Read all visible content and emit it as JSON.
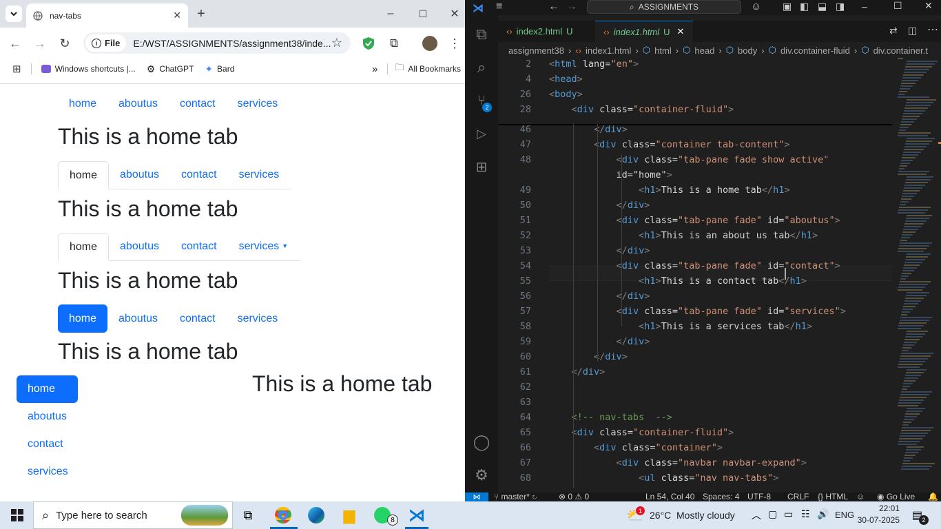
{
  "chrome": {
    "tab_title": "nav-tabs",
    "omnibox": {
      "scheme": "File",
      "url": "E:/WST/ASSIGNMENTS/assignment38/inde..."
    },
    "bookmarks": [
      "Windows shortcuts |...",
      "ChatGPT",
      "Bard"
    ],
    "all_bookmarks": "All Bookmarks",
    "accent": "#0d6efd"
  },
  "page": {
    "nav1": [
      "home",
      "aboutus",
      "contact",
      "services"
    ],
    "heading": "This is a home tab",
    "nav2": [
      "home",
      "aboutus",
      "contact",
      "services"
    ],
    "nav3": [
      "home",
      "aboutus",
      "contact",
      "services"
    ],
    "nav4": [
      "home",
      "aboutus",
      "contact",
      "services"
    ],
    "nav5": [
      "home",
      "aboutus",
      "contact",
      "services"
    ]
  },
  "vscode": {
    "title": "ASSIGNMENTS",
    "tabs": [
      {
        "name": "index2.html",
        "status": "U"
      },
      {
        "name": "index1.html",
        "status": "U"
      }
    ],
    "breadcrumbs": [
      "assignment38",
      "index1.html",
      "html",
      "head",
      "body",
      "div.container-fluid",
      "div.container.t"
    ],
    "sticky": [
      {
        "n": "2",
        "c": "<html lang=\"en\">"
      },
      {
        "n": "4",
        "c": "<head>"
      },
      {
        "n": "26",
        "c": "<body>"
      },
      {
        "n": "28",
        "c": "    <div class=\"container-fluid\">"
      }
    ],
    "lines": [
      {
        "n": "46",
        "c": "        </div>"
      },
      {
        "n": "47",
        "c": "        <div class=\"container tab-content\">"
      },
      {
        "n": "48",
        "c": "            <div class=\"tab-pane fade show active\""
      },
      {
        "n": "",
        "c": "            id=\"home\">"
      },
      {
        "n": "49",
        "c": "                <h1>This is a home tab</h1>"
      },
      {
        "n": "50",
        "c": "            </div>"
      },
      {
        "n": "51",
        "c": "            <div class=\"tab-pane fade\" id=\"aboutus\">"
      },
      {
        "n": "52",
        "c": "                <h1>This is an about us tab</h1>"
      },
      {
        "n": "53",
        "c": "            </div>"
      },
      {
        "n": "54",
        "c": "            <div class=\"tab-pane fade\" id=\"contact\">"
      },
      {
        "n": "55",
        "c": "                <h1>This is a contact tab</h1>"
      },
      {
        "n": "56",
        "c": "            </div>"
      },
      {
        "n": "57",
        "c": "            <div class=\"tab-pane fade\" id=\"services\">"
      },
      {
        "n": "58",
        "c": "                <h1>This is a services tab</h1>"
      },
      {
        "n": "59",
        "c": "            </div>"
      },
      {
        "n": "60",
        "c": "        </div>"
      },
      {
        "n": "61",
        "c": "    </div>"
      },
      {
        "n": "62",
        "c": ""
      },
      {
        "n": "63",
        "c": ""
      },
      {
        "n": "64",
        "c": "    <!-- nav-tabs  -->"
      },
      {
        "n": "65",
        "c": "    <div class=\"container-fluid\">"
      },
      {
        "n": "66",
        "c": "        <div class=\"container\">"
      },
      {
        "n": "67",
        "c": "            <div class=\"navbar navbar-expand\">"
      },
      {
        "n": "68",
        "c": "                <ul class=\"nav nav-tabs\">"
      }
    ],
    "scm_badge": "2",
    "status": {
      "branch": "master*",
      "problems": "0",
      "warnings": "0",
      "position": "Ln 54, Col 40",
      "spaces": "Spaces: 4",
      "encoding": "UTF-8",
      "eol": "CRLF",
      "language": "HTML",
      "golive": "Go Live"
    }
  },
  "taskbar": {
    "search_placeholder": "Type here to search",
    "weather_temp": "26°C",
    "weather_text": "Mostly cloudy",
    "weather_badge": "1",
    "lang": "ENG",
    "time": "22:01",
    "date": "30-07-2025",
    "whatsapp_badge": "8",
    "notif_badge": "2"
  }
}
